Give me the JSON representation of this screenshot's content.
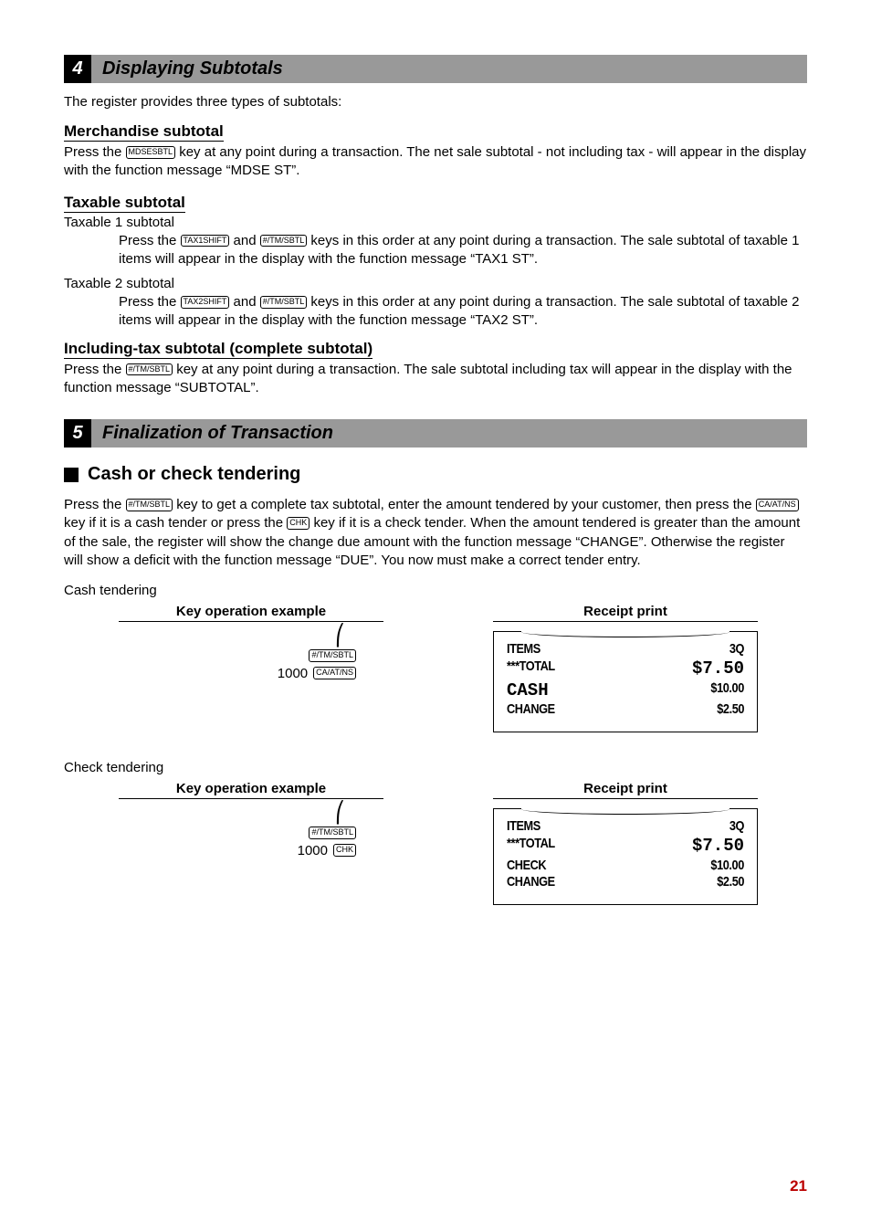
{
  "section4": {
    "number": "4",
    "title": "Displaying Subtotals",
    "intro": "The register provides three types of subtotals:",
    "merch": {
      "heading": "Merchandise subtotal",
      "pre": "Press the ",
      "key": "MDSESBTL",
      "post": " key at any point during a transaction. The net sale subtotal - not including tax - will appear in the display with the function message “MDSE ST”."
    },
    "taxable": {
      "heading": "Taxable subtotal",
      "t1_label": "Taxable 1 subtotal",
      "t1_pre": "Press the ",
      "t1_key1": "TAX1SHIFT",
      "t1_mid": " and ",
      "t1_key2": "#/TM/SBTL",
      "t1_post": " keys in this order at any point during a transaction. The sale subtotal of taxable 1 items will appear in the display with the function message “TAX1 ST”.",
      "t2_label": "Taxable 2 subtotal",
      "t2_pre": "Press the ",
      "t2_key1": "TAX2SHIFT",
      "t2_mid": " and ",
      "t2_key2": "#/TM/SBTL",
      "t2_post": " keys in this order at any point during a transaction. The sale subtotal of taxable 2 items will appear in the display with the function message “TAX2 ST”."
    },
    "including": {
      "heading": "Including-tax subtotal (complete subtotal)",
      "pre": "Press the ",
      "key": "#/TM/SBTL",
      "post": " key at any point during a transaction. The sale subtotal including tax will appear in the display with the function message “SUBTOTAL”."
    }
  },
  "section5": {
    "number": "5",
    "title": "Finalization of Transaction",
    "subsection": "Cash or check tendering",
    "para": {
      "p1": "Press the ",
      "k1": "#/TM/SBTL",
      "p2": " key to get a complete tax subtotal, enter the amount tendered by your customer, then press the ",
      "k2": "CA/AT/NS",
      "p3": " key if it is a cash tender or press the ",
      "k3": "CHK",
      "p4": " key if it is a check tender.  When the amount tendered is greater than the amount of the sale, the register will show the change due amount with the function message “CHANGE”.  Otherwise the register will show a deficit with the function message “DUE”.  You now must make a correct tender entry."
    },
    "cash": {
      "label": "Cash tendering",
      "keyop_header": "Key operation example",
      "receipt_header": "Receipt print",
      "amount": "1000",
      "key1": "#/TM/SBTL",
      "key2": "CA/AT/NS",
      "receipt": {
        "items_label": "ITEMS",
        "items_val": "3Q",
        "total_label": "***TOTAL",
        "total_val": "$7.50",
        "tender_label": "CASH",
        "tender_val": "$10.00",
        "change_label": "CHANGE",
        "change_val": "$2.50"
      }
    },
    "check": {
      "label": "Check tendering",
      "keyop_header": "Key operation example",
      "receipt_header": "Receipt print",
      "amount": "1000",
      "key1": "#/TM/SBTL",
      "key2": "CHK",
      "receipt": {
        "items_label": "ITEMS",
        "items_val": "3Q",
        "total_label": "***TOTAL",
        "total_val": "$7.50",
        "tender_label": "CHECK",
        "tender_val": "$10.00",
        "change_label": "CHANGE",
        "change_val": "$2.50"
      }
    }
  },
  "page_number": "21"
}
